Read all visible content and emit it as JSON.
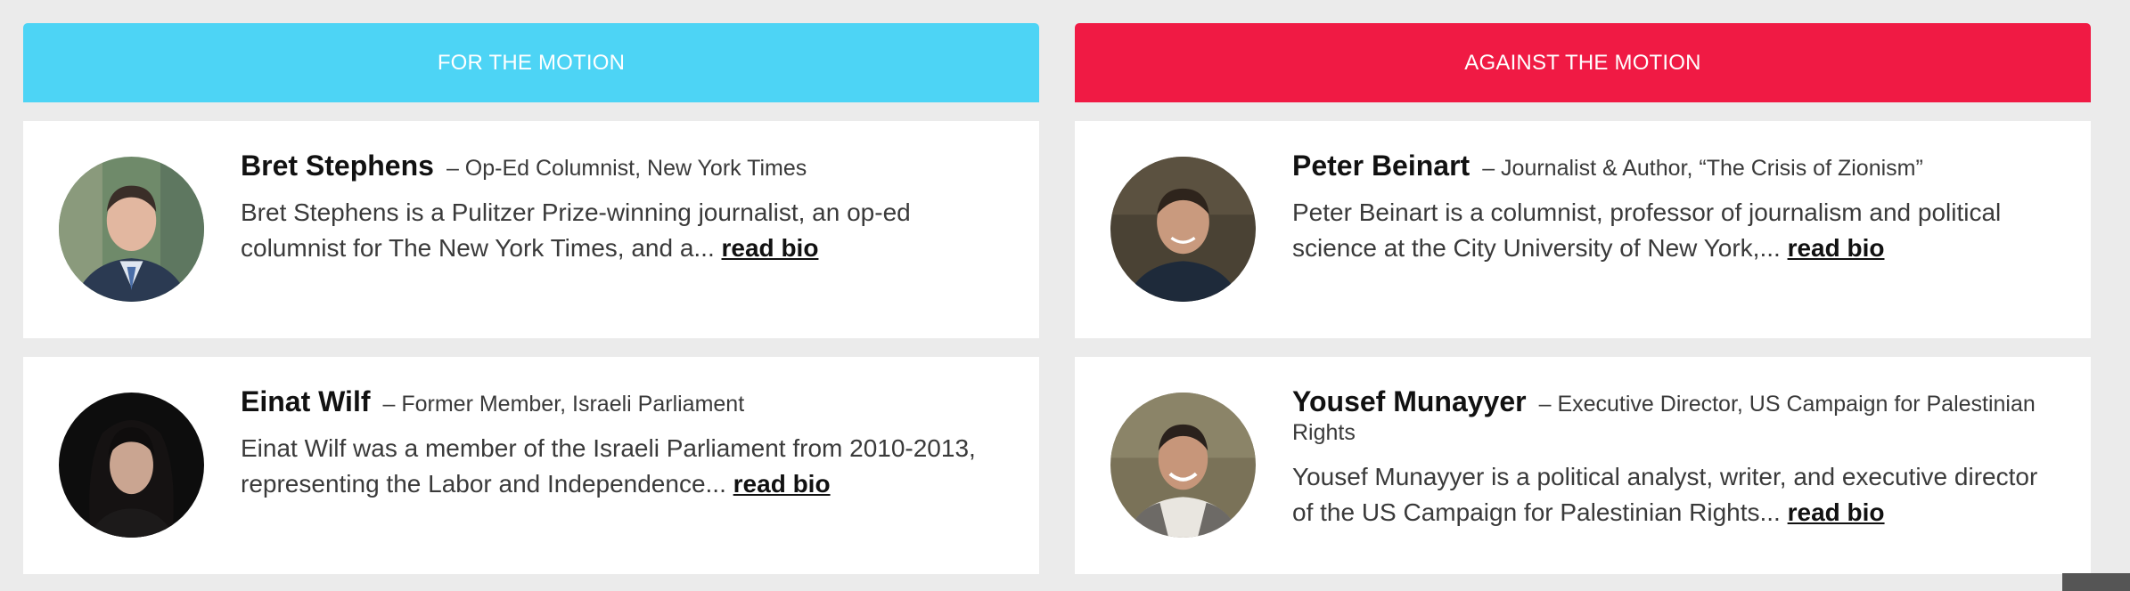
{
  "for_side": {
    "header": "FOR THE MOTION",
    "color": "#4dd4f5",
    "speakers": [
      {
        "name": "Bret Stephens",
        "title": "– Op-Ed Columnist, New York Times",
        "bio": "Bret Stephens is a Pulitzer Prize-winning journalist, an op-ed columnist for The New York Times, and a...",
        "link": "read bio"
      },
      {
        "name": "Einat Wilf",
        "title": "– Former Member, Israeli Parliament",
        "bio": "Einat Wilf was a member of the Israeli Parliament from 2010-2013, representing the Labor and Independence...",
        "link": "read bio"
      }
    ]
  },
  "against_side": {
    "header": "AGAINST THE MOTION",
    "color": "#f01a44",
    "speakers": [
      {
        "name": "Peter Beinart",
        "title": "– Journalist & Author, “The Crisis of Zionism”",
        "bio": "Peter Beinart is a columnist, professor of journalism and political science at the City University of New York,...",
        "link": "read bio"
      },
      {
        "name": "Yousef Munayyer",
        "title": "– Executive Director, US Campaign for Palestinian Rights",
        "bio": "Yousef Munayyer is a political analyst, writer, and executive director of the US Campaign for Palestinian Rights...",
        "link": "read bio"
      }
    ]
  }
}
